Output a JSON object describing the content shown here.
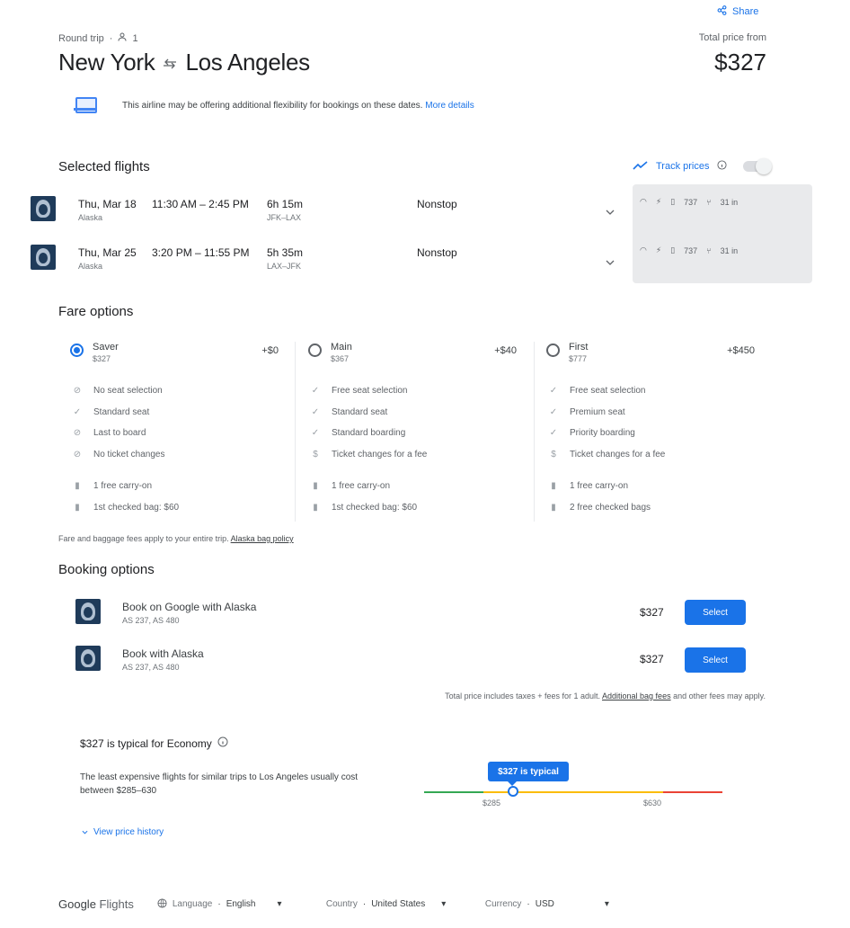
{
  "header": {
    "share": "Share",
    "trip_type": "Round trip",
    "passengers": "1",
    "origin": "New York",
    "destination": "Los Angeles",
    "total_label": "Total price from",
    "total_price": "$327"
  },
  "flex_note": {
    "text": "This airline may be offering additional flexibility for bookings on these dates.",
    "link": "More details"
  },
  "selected_flights": {
    "title": "Selected flights",
    "track_prices": "Track prices",
    "flights": [
      {
        "date": "Thu, Mar 18",
        "times": "11:30 AM – 2:45 PM",
        "airline": "Alaska",
        "duration": "6h 15m",
        "airports": "JFK–LAX",
        "stops": "Nonstop",
        "legroom": "31 in",
        "plane": "737"
      },
      {
        "date": "Thu, Mar 25",
        "times": "3:20 PM – 11:55 PM",
        "airline": "Alaska",
        "duration": "5h 35m",
        "airports": "LAX–JFK",
        "stops": "Nonstop",
        "legroom": "31 in",
        "plane": "737"
      }
    ]
  },
  "fare_options": {
    "title": "Fare options",
    "fares": [
      {
        "name": "Saver",
        "price": "$327",
        "diff": "+$0",
        "features": [
          "No seat selection",
          "Standard seat",
          "Last to board",
          "No ticket changes",
          "1 free carry-on",
          "1st checked bag: $60"
        ]
      },
      {
        "name": "Main",
        "price": "$367",
        "diff": "+$40",
        "features": [
          "Free seat selection",
          "Standard seat",
          "Standard boarding",
          "Ticket changes for a fee",
          "1 free carry-on",
          "1st checked bag: $60"
        ]
      },
      {
        "name": "First",
        "price": "$777",
        "diff": "+$450",
        "features": [
          "Free seat selection",
          "Premium seat",
          "Priority boarding",
          "Ticket changes for a fee",
          "1 free carry-on",
          "2 free checked bags"
        ]
      }
    ],
    "note": "Fare and baggage fees apply to your entire trip.",
    "note_link": "Alaska bag policy"
  },
  "booking_options": {
    "title": "Booking options",
    "options": [
      {
        "name": "Book on Google with Alaska",
        "flights": "AS 237, AS 480",
        "price": "$327",
        "button": "Select"
      },
      {
        "name": "Book with Alaska",
        "flights": "AS 237, AS 480",
        "price": "$327",
        "button": "Select"
      }
    ],
    "disclaimer_pre": "Total price includes taxes + fees for 1 adult.",
    "disclaimer_link": "Additional bag fees",
    "disclaimer_post": "and other fees may apply."
  },
  "price_insight": {
    "title": "$327 is typical for Economy",
    "text": "The least expensive flights for similar trips to Los Angeles usually cost between $285–630",
    "badge": "$327 is typical",
    "low": "$285",
    "high": "$630",
    "history": "View price history"
  },
  "footer": {
    "brand_google": "Google",
    "brand_flights": "Flights",
    "language_label": "Language",
    "language_value": "English",
    "country_label": "Country",
    "country_value": "United States",
    "currency_label": "Currency",
    "currency_value": "USD"
  },
  "colors": {
    "accent": "#1a73e8",
    "low": "#34a853",
    "typical": "#fbbc04",
    "high": "#ea4335"
  }
}
